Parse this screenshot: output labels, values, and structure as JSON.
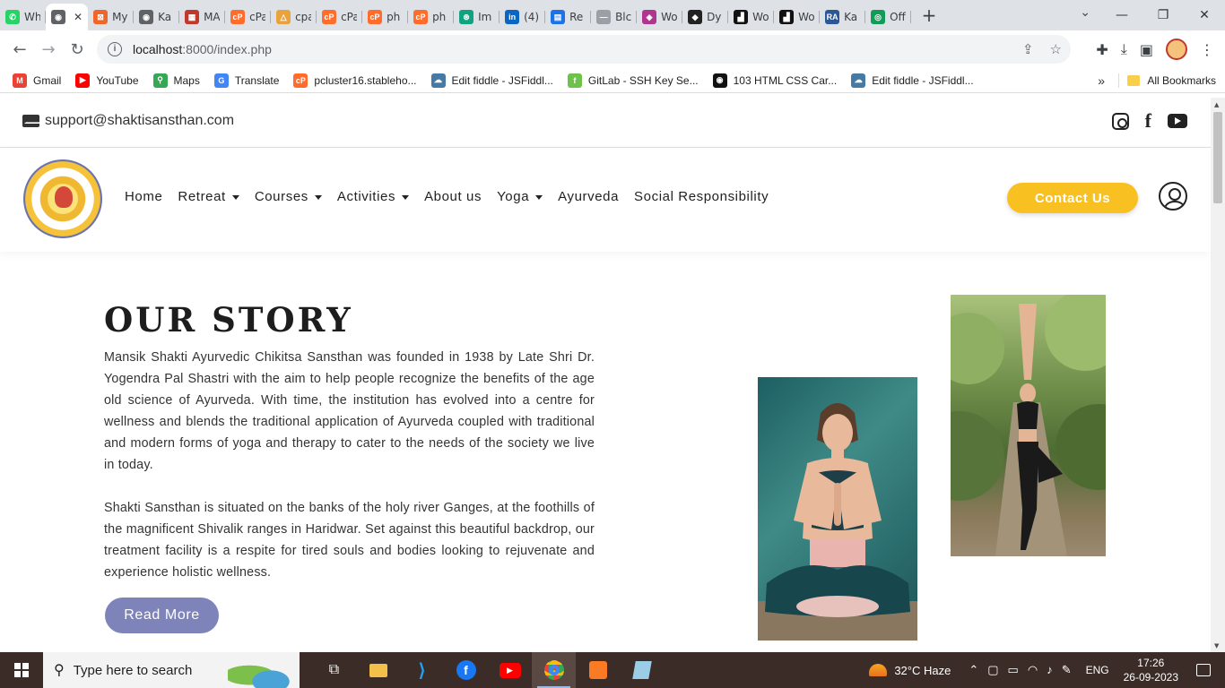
{
  "browser": {
    "tabs": [
      {
        "title": "Wh",
        "favicon_color": "#25d366",
        "favicon_glyph": "✆"
      },
      {
        "title": "",
        "favicon_color": "#5f6368",
        "favicon_glyph": "◉",
        "active": true
      },
      {
        "title": "My",
        "favicon_color": "#f06529",
        "favicon_glyph": "⊠"
      },
      {
        "title": "Ka",
        "favicon_color": "#5f6368",
        "favicon_glyph": "◉"
      },
      {
        "title": "MA",
        "favicon_color": "#c0392b",
        "favicon_glyph": "▦"
      },
      {
        "title": "cPa",
        "favicon_color": "#ff6c2c",
        "favicon_glyph": "cP"
      },
      {
        "title": "cpa",
        "favicon_color": "#e8a33d",
        "favicon_glyph": "△"
      },
      {
        "title": "cPa",
        "favicon_color": "#ff6c2c",
        "favicon_glyph": "cP"
      },
      {
        "title": "ph",
        "favicon_color": "#ff6c2c",
        "favicon_glyph": "cP"
      },
      {
        "title": "ph",
        "favicon_color": "#ff6c2c",
        "favicon_glyph": "cP"
      },
      {
        "title": "Im",
        "favicon_color": "#10a37f",
        "favicon_glyph": "⊛"
      },
      {
        "title": "(4)",
        "favicon_color": "#0a66c2",
        "favicon_glyph": "in"
      },
      {
        "title": "Re",
        "favicon_color": "#1a73e8",
        "favicon_glyph": "▤"
      },
      {
        "title": "Blc",
        "favicon_color": "#9aa0a6",
        "favicon_glyph": "—"
      },
      {
        "title": "Wo",
        "favicon_color": "#b0358e",
        "favicon_glyph": "◈"
      },
      {
        "title": "Dy",
        "favicon_color": "#222222",
        "favicon_glyph": "◆"
      },
      {
        "title": "Wo",
        "favicon_color": "#111111",
        "favicon_glyph": "▟"
      },
      {
        "title": "Wo",
        "favicon_color": "#111111",
        "favicon_glyph": "▟"
      },
      {
        "title": "Ka",
        "favicon_color": "#2b5797",
        "favicon_glyph": "RA"
      },
      {
        "title": "Off",
        "favicon_color": "#0f9d58",
        "favicon_glyph": "◎"
      }
    ],
    "url_host": "localhost",
    "url_rest": ":8000/index.php",
    "bookmarks": [
      {
        "label": "Gmail",
        "color": "#ea4335",
        "glyph": "M"
      },
      {
        "label": "YouTube",
        "color": "#ff0000",
        "glyph": "▶"
      },
      {
        "label": "Maps",
        "color": "#34a853",
        "glyph": "⚲"
      },
      {
        "label": "Translate",
        "color": "#4285f4",
        "glyph": "G"
      },
      {
        "label": "pcluster16.stableho...",
        "color": "#ff6c2c",
        "glyph": "cP"
      },
      {
        "label": "Edit fiddle - JSFiddl...",
        "color": "#4679a4",
        "glyph": "☁"
      },
      {
        "label": "GitLab - SSH Key Se...",
        "color": "#6cc24a",
        "glyph": "f"
      },
      {
        "label": "103 HTML CSS Car...",
        "color": "#111111",
        "glyph": "◉"
      },
      {
        "label": "Edit fiddle - JSFiddl...",
        "color": "#4679a4",
        "glyph": "☁"
      }
    ],
    "bookmarks_more": "»",
    "all_bookmarks": "All Bookmarks"
  },
  "site": {
    "email": "support@shaktisansthan.com",
    "nav": [
      {
        "label": "Home",
        "dropdown": false
      },
      {
        "label": "Retreat",
        "dropdown": true
      },
      {
        "label": "Courses",
        "dropdown": true
      },
      {
        "label": "Activities",
        "dropdown": true
      },
      {
        "label": "About us",
        "dropdown": false
      },
      {
        "label": "Yoga",
        "dropdown": true
      },
      {
        "label": "Ayurveda",
        "dropdown": false
      },
      {
        "label": "Social Responsibility",
        "dropdown": false
      }
    ],
    "contact_button": "Contact Us",
    "story": {
      "title": "OUR STORY",
      "paragraph1": "Mansik Shakti Ayurvedic Chikitsa Sansthan was founded in 1938 by Late Shri Dr. Yogendra Pal Shastri with the aim to help people recognize the benefits of the age old science of Ayurveda. With time, the institution has evolved into a centre for wellness and blends the traditional application of Ayurveda coupled with traditional and modern forms of yoga and therapy to cater to the needs of the society we live in today.",
      "paragraph2": "Shakti Sansthan is situated on the banks of the holy river Ganges, at the foothills of the magnificent Shivalik ranges in Haridwar. Set against this beautiful backdrop, our treatment facility is a respite for tired souls and bodies looking to rejuvenate and experience holistic wellness.",
      "read_more": "Read More"
    },
    "accent_yellow": "#f8c020",
    "accent_purple": "#7e83b9"
  },
  "taskbar": {
    "search_placeholder": "Type here to search",
    "weather": "32°C  Haze",
    "language": "ENG",
    "time": "17:26",
    "date": "26-09-2023"
  }
}
